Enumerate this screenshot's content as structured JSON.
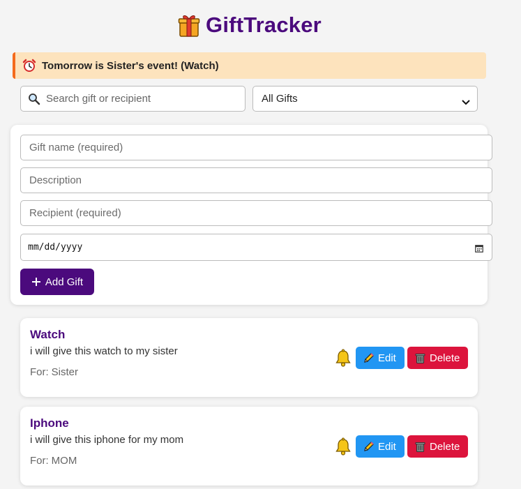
{
  "app": {
    "title": "GiftTracker",
    "logo_icon": "gift-icon"
  },
  "alert": {
    "text": "Tomorrow is Sister's event! (Watch)",
    "icon": "alarm-clock-icon"
  },
  "search": {
    "placeholder": "Search gift or recipient",
    "value": ""
  },
  "filter": {
    "selected": "All Gifts"
  },
  "form": {
    "gift_name_placeholder": "Gift name (required)",
    "description_placeholder": "Description",
    "recipient_placeholder": "Recipient (required)",
    "date_placeholder": "mm/dd/yyyy",
    "add_button_label": "Add Gift"
  },
  "gifts": [
    {
      "name": "Watch",
      "description": "i will give this watch to my sister",
      "for_label": "For:",
      "recipient": "Sister",
      "edit_label": "Edit",
      "delete_label": "Delete"
    },
    {
      "name": "Iphone",
      "description": "i will give this iphone for my mom",
      "for_label": "For:",
      "recipient": "MOM",
      "edit_label": "Edit",
      "delete_label": "Delete"
    }
  ],
  "colors": {
    "accent": "#4b0a7d",
    "alert_bg": "#fde3bd",
    "alert_border": "#f46a1d",
    "edit": "#2196f3",
    "delete": "#dc143c"
  }
}
